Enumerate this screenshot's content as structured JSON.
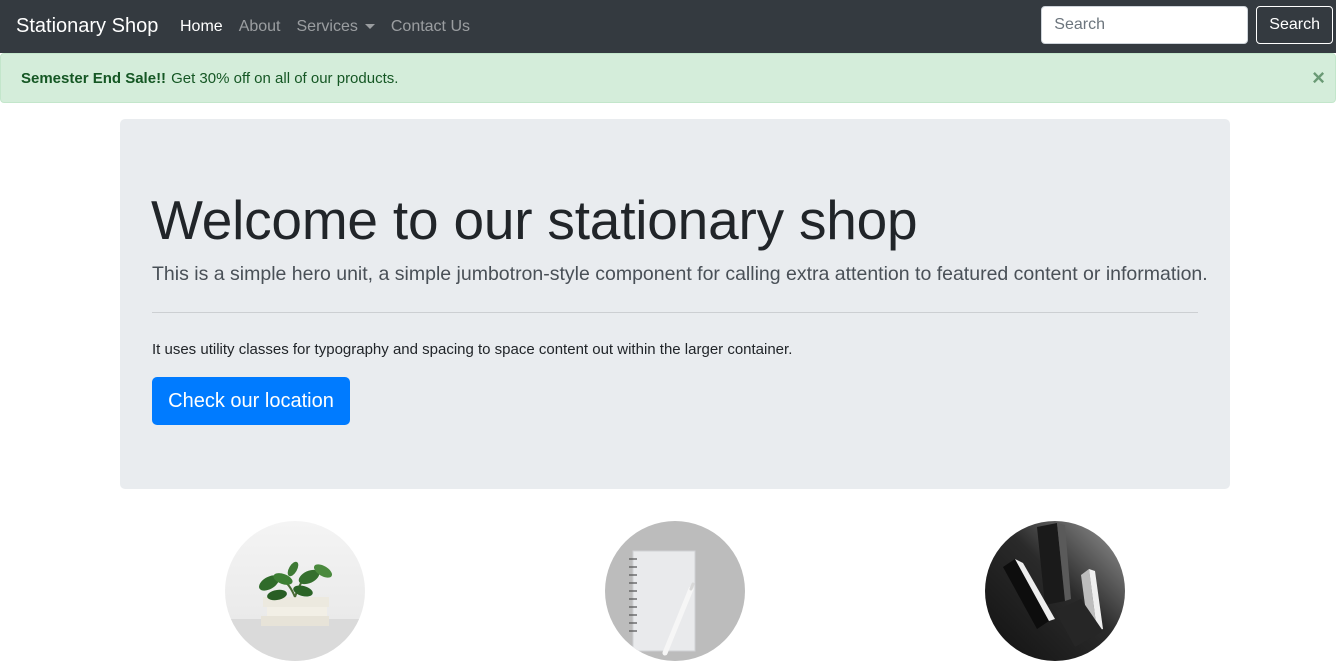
{
  "navbar": {
    "brand": "Stationary Shop",
    "links": [
      {
        "label": "Home",
        "active": true
      },
      {
        "label": "About",
        "active": false
      },
      {
        "label": "Services",
        "active": false,
        "dropdown": true
      },
      {
        "label": "Contact Us",
        "active": false
      }
    ],
    "search": {
      "placeholder": "Search",
      "value": "",
      "button_label": "Search"
    }
  },
  "alert": {
    "strong": "Semester End Sale!!",
    "text": "Get 30% off on all of our products.",
    "close_glyph": "×"
  },
  "jumbotron": {
    "title": "Welcome to our stationary shop",
    "lead": "This is a simple hero unit, a simple jumbotron-style component for calling extra attention to featured content or information.",
    "text": "It uses utility classes for typography and spacing to space content out within the larger container.",
    "button_label": "Check our location"
  },
  "images": [
    {
      "icon": "plant-on-books-image"
    },
    {
      "icon": "notebook-and-pen-image"
    },
    {
      "icon": "black-blocks-image"
    }
  ],
  "colors": {
    "navbar_bg": "#343a40",
    "alert_bg": "#d4edda",
    "alert_text": "#155724",
    "jumbotron_bg": "#e9ecef",
    "primary": "#007bff"
  }
}
